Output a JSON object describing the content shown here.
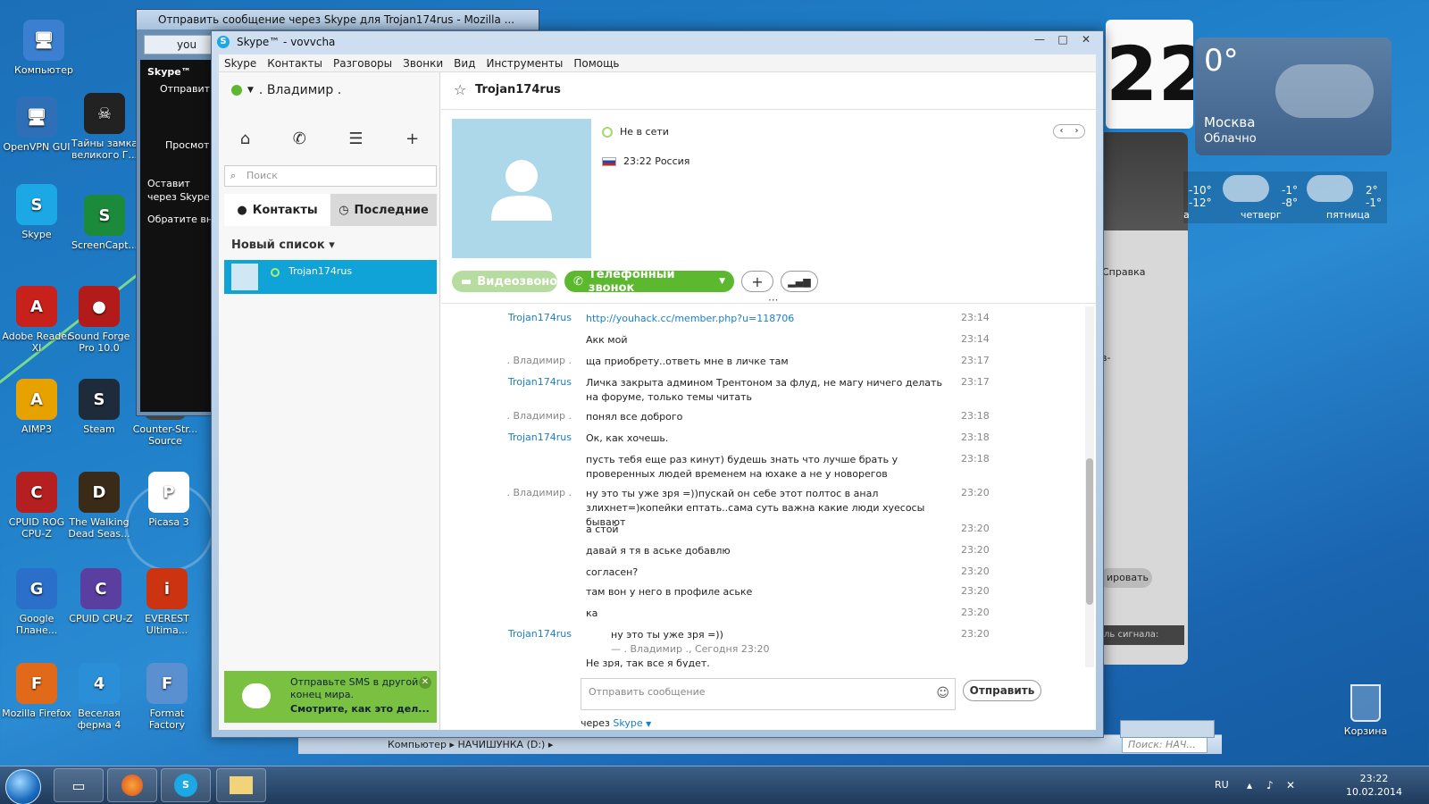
{
  "desktop": {
    "icons": [
      {
        "label": "Компьютер",
        "glyph": "🖥"
      },
      {
        "label": "OpenVPN GUI",
        "glyph": "🖥"
      },
      {
        "label": "Тайны замка великого Г...",
        "glyph": "☠"
      },
      {
        "label": "Skype",
        "glyph": "S"
      },
      {
        "label": "ScreenCapt...",
        "glyph": "S"
      },
      {
        "label": "Adobe Reader XI",
        "glyph": "A"
      },
      {
        "label": "Sound Forge Pro 10.0",
        "glyph": "●"
      },
      {
        "label": "AIMP3",
        "glyph": "A"
      },
      {
        "label": "Steam",
        "glyph": "S"
      },
      {
        "label": "Counter-Str... Source",
        "glyph": "C"
      },
      {
        "label": "CPUID ROG CPU-Z",
        "glyph": "C"
      },
      {
        "label": "The Walking Dead Seas...",
        "glyph": "D"
      },
      {
        "label": "Picasa 3",
        "glyph": "P"
      },
      {
        "label": "Google Плане...",
        "glyph": "G"
      },
      {
        "label": "CPUID CPU-Z",
        "glyph": "C"
      },
      {
        "label": "EVEREST Ultima...",
        "glyph": "i"
      },
      {
        "label": "Mozilla Firefox",
        "glyph": "F"
      },
      {
        "label": "Веселая ферма 4",
        "glyph": "4"
      },
      {
        "label": "Format Factory",
        "glyph": "F"
      }
    ],
    "recycle_bin": "Корзина"
  },
  "firefox_window": {
    "title": "Отправить сообщение через Skype для Trojan174rus - Mozilla ...",
    "tab_text": "you",
    "sidebar": {
      "brand": "Skype™",
      "line1": "Отправит",
      "line2": "Просмот",
      "line3": "Оставит",
      "line4": "через Skype",
      "line5": "Обратите вни"
    }
  },
  "weather": {
    "temp": "0°",
    "city": "Москва",
    "condition": "Облачно",
    "clock_digits": "22",
    "forecast": [
      {
        "hi": "-10°",
        "lo": "-12°",
        "day": "а"
      },
      {
        "hi": "-1°",
        "lo": "-8°",
        "day": "четверг"
      },
      {
        "hi": "2°",
        "lo": "-1°",
        "day": "пятница"
      }
    ],
    "help_label": "Справка",
    "side_text1": "ів-",
    "side_text2": "ировать",
    "side_text3": "ль сигнала:"
  },
  "explorer": {
    "crumbs": "Компьютер ▸ НАЧИШУНКА (D:) ▸",
    "search_placeholder": "Поиск: НАЧ..."
  },
  "taskbar": {
    "lang": "RU",
    "time": "23:22",
    "date": "10.02.2014"
  },
  "skype": {
    "title": "Skype™ - vovvcha",
    "menu": [
      "Skype",
      "Контакты",
      "Разговоры",
      "Звонки",
      "Вид",
      "Инструменты",
      "Помощь"
    ],
    "me_name": ". Владимир .",
    "search_placeholder": "Поиск",
    "tab_contacts": "Контакты",
    "tab_recent": "Последние",
    "list_name": "Новый список",
    "contact_name": "Trojan174rus",
    "promo_line1": "Отправьте SMS в другой конец мира.",
    "promo_line2": "Смотрите, как это дел...",
    "chat_name": "Trojan174rus",
    "status": "Не в сети",
    "local_time": "23:22 Россия",
    "btn_video": "Видеозвонок",
    "btn_phone": "Телефонный звонок",
    "compose_placeholder": "Отправить сообщение",
    "send_label": "Отправить",
    "via_prefix": "через",
    "via_brand": "Skype",
    "messages": [
      {
        "who": "Trojan174rus",
        "me": false,
        "text": "http://youhack.cc/member.php?u=118706",
        "time": "23:14",
        "link": true
      },
      {
        "who": "",
        "me": false,
        "text": "Акк мой",
        "time": "23:14"
      },
      {
        "who": ". Владимир .",
        "me": true,
        "text": "ща приобрету..ответь мне в личке там",
        "time": "23:17"
      },
      {
        "who": "Trojan174rus",
        "me": false,
        "text": "Личка закрыта админом Трентоном за флуд, не магу ничего делать на форуме, только темы читать",
        "time": "23:17"
      },
      {
        "who": ". Владимир .",
        "me": true,
        "text": "понял все доброго",
        "time": "23:18"
      },
      {
        "who": "Trojan174rus",
        "me": false,
        "text": "Ок, как хочешь.",
        "time": "23:18"
      },
      {
        "who": "",
        "me": false,
        "text": "пусть тебя еще раз кинут) будешь знать что лучше брать у проверенных людей временем на юхаке а не у новорегов",
        "time": "23:18"
      },
      {
        "who": ". Владимир .",
        "me": true,
        "text": "ну это ты уже зря =))пускай он себе этот полтос в анал злихнет=)копейки ептать..сама суть важна какие люди хуесосы бывают",
        "time": "23:20"
      },
      {
        "who": "",
        "me": true,
        "text": "а стой",
        "time": "23:20"
      },
      {
        "who": "",
        "me": true,
        "text": "давай я тя в аське добавлю",
        "time": "23:20"
      },
      {
        "who": "",
        "me": true,
        "text": "согласен?",
        "time": "23:20"
      },
      {
        "who": "",
        "me": true,
        "text": "там вон у него в профиле аське",
        "time": "23:20"
      },
      {
        "who": "",
        "me": true,
        "text": "ка",
        "time": "23:20"
      },
      {
        "who": "Trojan174rus",
        "me": false,
        "quote": "ну это ты уже зря =))",
        "quote_meta": "— . Владимир ., Сегодня 23:20",
        "text": "Не зря,  так все я будет.",
        "time": "23:20"
      }
    ]
  }
}
